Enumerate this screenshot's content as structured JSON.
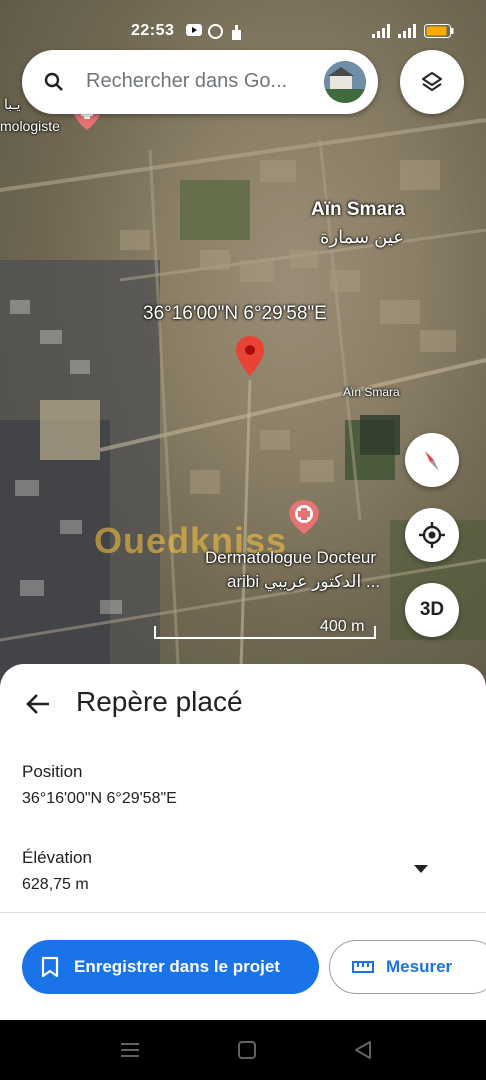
{
  "status_bar": {
    "time": "22:53",
    "icons_left": [
      "youtube-icon",
      "whatsapp-icon",
      "hand-icon"
    ],
    "icons_right": [
      "signal-icon",
      "signal-icon",
      "battery-icon"
    ]
  },
  "search": {
    "placeholder": "Rechercher dans Go..."
  },
  "map": {
    "place_name": "Aïn Smara",
    "place_name_ar": "عين سمارة",
    "coordinates_label": "36°16'00\"N 6°29'58\"E",
    "street_label": "Aïn Smara",
    "poi_name_line1": "Dermatologue Docteur",
    "poi_name_line2": "aribi الدكتور عريبي ...",
    "poi_left_line1": "يـبا",
    "poi_left_line2": "mologiste",
    "watermark": "Ouedkniss",
    "scale": "400 m",
    "button_3d": "3D"
  },
  "sheet": {
    "title": "Repère placé",
    "position_label": "Position",
    "position_value": "36°16'00\"N 6°29'58\"E",
    "elevation_label": "Élévation",
    "elevation_value": "628,75 m",
    "save_label": "Enregistrer dans le projet",
    "measure_label": "Mesurer"
  },
  "colors": {
    "accent": "#1a73e8",
    "pin": "#ea4335"
  }
}
